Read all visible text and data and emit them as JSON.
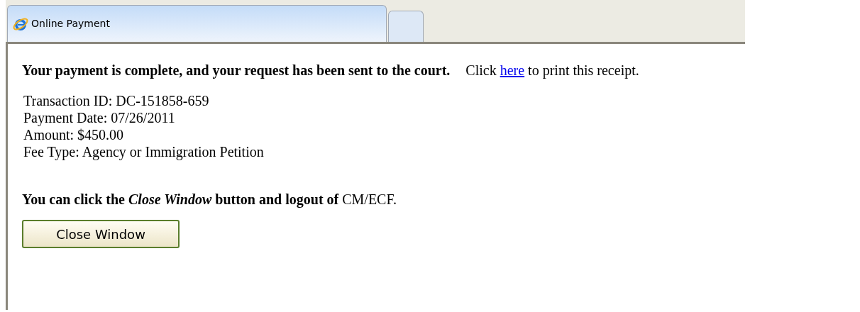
{
  "tabs": [
    {
      "label": "Online Payment",
      "selected": true
    },
    {
      "selected": false
    }
  ],
  "confirmation": {
    "message": "Your payment is complete, and your request has been sent to the court.",
    "print_prefix": "Click",
    "print_link": "here",
    "print_suffix": "to print this receipt."
  },
  "details": [
    "Transaction ID: DC-151858-659",
    "Payment Date: 07/26/2011",
    "Amount: $450.00",
    "Fee Type: Agency or Immigration Petition"
  ],
  "instruction": "**You can click the *Close Window* button and logout of** CM/ECF.",
  "close_button": "Close Window"
}
